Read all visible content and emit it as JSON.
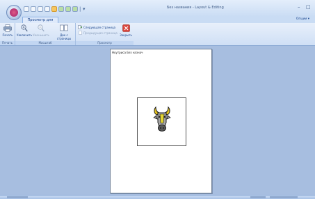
{
  "window": {
    "title": "Без названия - Layout & Editing",
    "minimize_glyph": "–",
    "maximize_glyph": "□"
  },
  "quick_access": {
    "icons": [
      "new-icon",
      "open-icon",
      "save-icon",
      "print-icon",
      "preview-icon",
      "globe-icon",
      "undo-icon",
      "redo-icon",
      "dropdown-icon"
    ],
    "separator": "|"
  },
  "tabs": {
    "active_label": "Просмотр для печати",
    "options_label": "Опции"
  },
  "ribbon": {
    "print_group": {
      "label": "Печать",
      "print_button": "Печать"
    },
    "zoom_group": {
      "label": "Масштаб",
      "zoom_in": "Увеличить",
      "zoom_out": "Уменьшить",
      "two_pages": "Две с страницы"
    },
    "preview_group": {
      "label": "Просмотр",
      "next_page": "Следующая страница",
      "prev_page": "Предыдущая страница",
      "close": "Закрыть"
    }
  },
  "document": {
    "header_text": "Ноутриса Без назнач",
    "image_icon": "bull-head-icon"
  },
  "colors": {
    "accent": "#15428b",
    "workspace": "#a7bee0",
    "close_button": "#d9463c"
  }
}
